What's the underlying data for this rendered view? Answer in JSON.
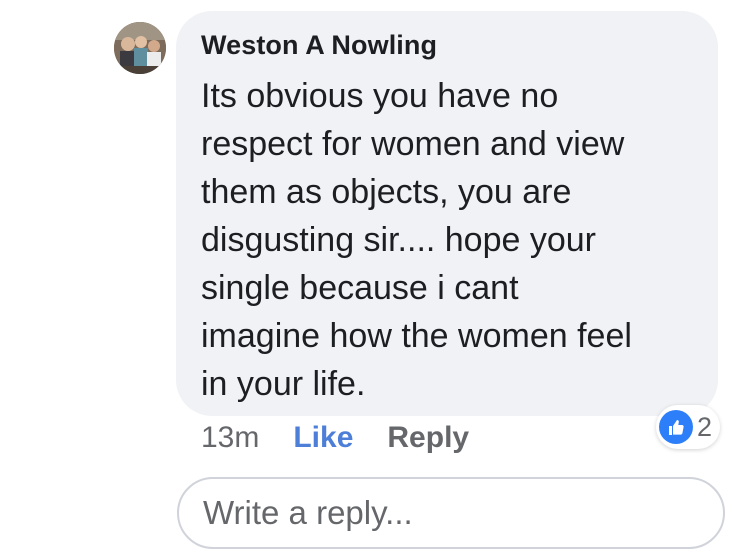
{
  "comment": {
    "author": "Weston A Nowling",
    "text": "Its obvious you have no\nrespect for women and view\nthem as objects,  you are\ndisgusting sir.... hope your\nsingle because i cant\nimagine how the women feel\nin your life.",
    "timestamp": "13m",
    "like_label": "Like",
    "reply_label": "Reply",
    "reaction": {
      "icon": "thumbs-up-icon",
      "count": "2",
      "color": "#2d7ff9"
    }
  },
  "reply_box": {
    "placeholder": "Write a reply..."
  },
  "colors": {
    "bubble": "#f0f2f5",
    "link_active": "#4d7fd8",
    "secondary_text": "#65676b"
  }
}
